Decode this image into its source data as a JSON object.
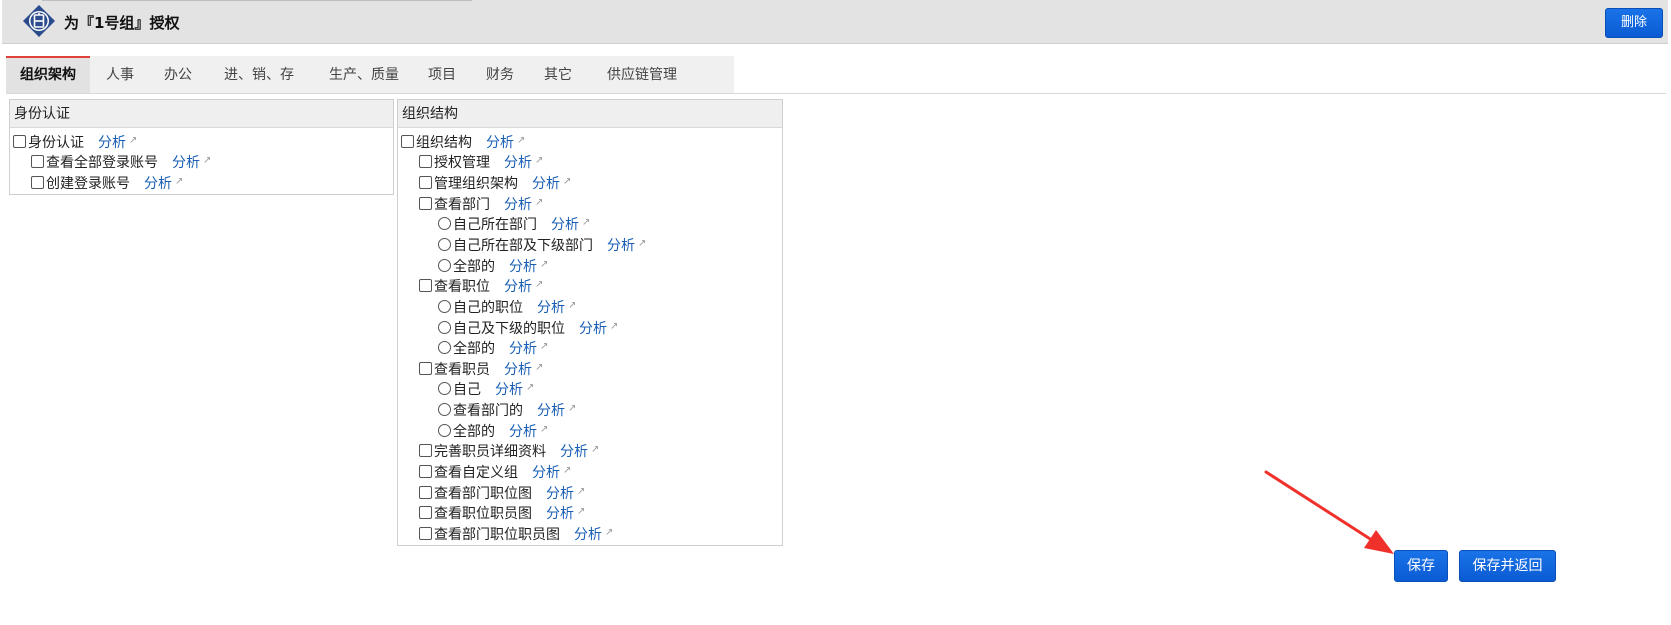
{
  "header": {
    "title": "为『1号组』授权",
    "delete_label": "删除"
  },
  "tabs": [
    {
      "label": "组织架构",
      "active": true
    },
    {
      "label": "人事"
    },
    {
      "label": "办公"
    },
    {
      "label": "进、销、存"
    },
    {
      "label": "生产、质量"
    },
    {
      "label": "项目"
    },
    {
      "label": "财务"
    },
    {
      "label": "其它"
    },
    {
      "label": "供应链管理"
    }
  ],
  "panels": {
    "identity": {
      "title": "身份认证",
      "items": [
        {
          "type": "checkbox",
          "label": "身份认证",
          "link": "分析"
        },
        {
          "type": "checkbox",
          "label": "查看全部登录账号",
          "link": "分析"
        },
        {
          "type": "checkbox",
          "label": "创建登录账号",
          "link": "分析"
        }
      ]
    },
    "org": {
      "title": "组织结构",
      "items": [
        {
          "type": "checkbox",
          "label": "组织结构",
          "link": "分析"
        },
        {
          "type": "checkbox",
          "label": "授权管理",
          "link": "分析"
        },
        {
          "type": "checkbox",
          "label": "管理组织架构",
          "link": "分析"
        },
        {
          "type": "checkbox",
          "label": "查看部门",
          "link": "分析"
        },
        {
          "type": "radio",
          "label": "自己所在部门",
          "link": "分析"
        },
        {
          "type": "radio",
          "label": "自己所在部及下级部门",
          "link": "分析"
        },
        {
          "type": "radio",
          "label": "全部的",
          "link": "分析"
        },
        {
          "type": "checkbox",
          "label": "查看职位",
          "link": "分析"
        },
        {
          "type": "radio",
          "label": "自己的职位",
          "link": "分析"
        },
        {
          "type": "radio",
          "label": "自己及下级的职位",
          "link": "分析"
        },
        {
          "type": "radio",
          "label": "全部的",
          "link": "分析"
        },
        {
          "type": "checkbox",
          "label": "查看职员",
          "link": "分析"
        },
        {
          "type": "radio",
          "label": "自己",
          "link": "分析"
        },
        {
          "type": "radio",
          "label": "查看部门的",
          "link": "分析"
        },
        {
          "type": "radio",
          "label": "全部的",
          "link": "分析"
        },
        {
          "type": "checkbox",
          "label": "完善职员详细资料",
          "link": "分析"
        },
        {
          "type": "checkbox",
          "label": "查看自定义组",
          "link": "分析"
        },
        {
          "type": "checkbox",
          "label": "查看部门职位图",
          "link": "分析"
        },
        {
          "type": "checkbox",
          "label": "查看职位职员图",
          "link": "分析"
        },
        {
          "type": "checkbox",
          "label": "查看部门职位职员图",
          "link": "分析"
        }
      ]
    }
  },
  "footer": {
    "save_label": "保存",
    "save_return_label": "保存并返回"
  },
  "icons": {
    "logo": "app-logo-icon",
    "external": "external-link-icon",
    "annotation": "red-arrow-annotation"
  },
  "colors": {
    "accent": "#1a73e8",
    "link": "#1a5fb4",
    "active_tab_border": "#e0413b",
    "annotation_arrow": "#f0302a"
  }
}
